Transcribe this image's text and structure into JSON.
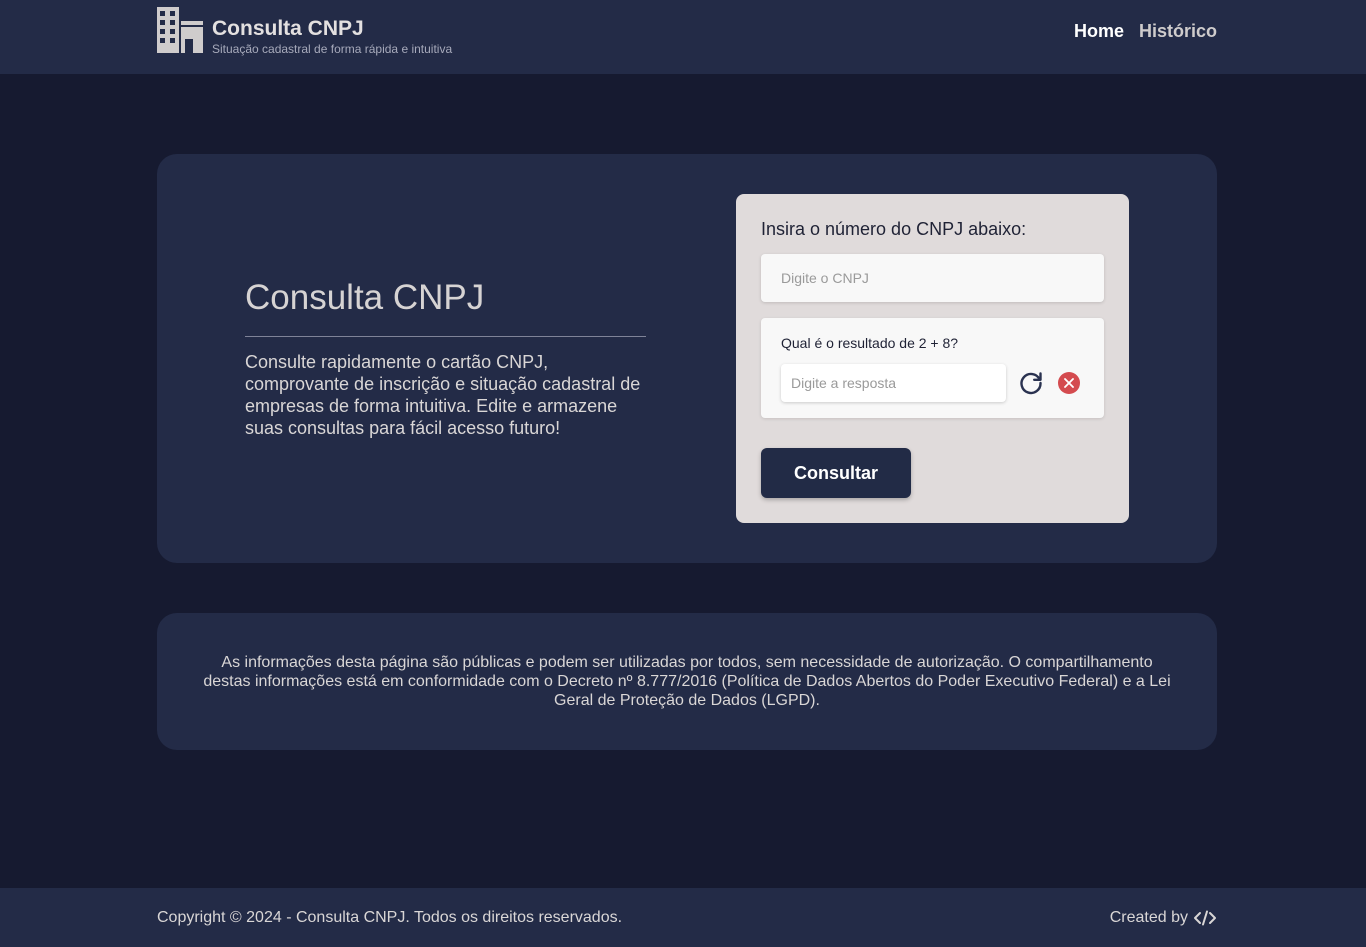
{
  "header": {
    "title": "Consulta CNPJ",
    "subtitle": "Situação cadastral de forma rápida e intuitiva",
    "logo_icon": "building-icon",
    "nav": [
      {
        "label": "Home",
        "active": true
      },
      {
        "label": "Histórico",
        "active": false
      }
    ]
  },
  "hero": {
    "title": "Consulta CNPJ",
    "description": "Consulte rapidamente o cartão CNPJ, comprovante de inscrição e situação cadastral de empresas de forma intuitiva. Edite e armazene suas consultas para fácil acesso futuro!"
  },
  "form": {
    "label": "Insira o número do CNPJ abaixo:",
    "cnpj_placeholder": "Digite o CNPJ",
    "cnpj_value": "",
    "captcha": {
      "question": "Qual é o resultado de 2 + 8?",
      "placeholder": "Digite a resposta",
      "value": "",
      "refresh_icon": "refresh-icon",
      "clear_icon": "close-circle-icon"
    },
    "submit_label": "Consultar"
  },
  "info": {
    "text": "As informações desta página são públicas e podem ser utilizadas por todos, sem necessidade de autorização. O compartilhamento destas informações está em conformidade com o Decreto nº 8.777/2016 (Política de Dados Abertos do Poder Executivo Federal) e a Lei Geral de Proteção de Dados (LGPD)."
  },
  "footer": {
    "copyright": "Copyright © 2024 - Consulta CNPJ. Todos os direitos reservados.",
    "created_by": "Created by",
    "created_icon": "code-icon"
  },
  "colors": {
    "background": "#161a30",
    "card": "#232b47",
    "form_card": "#e0dbdb",
    "danger": "#d44b4f"
  }
}
